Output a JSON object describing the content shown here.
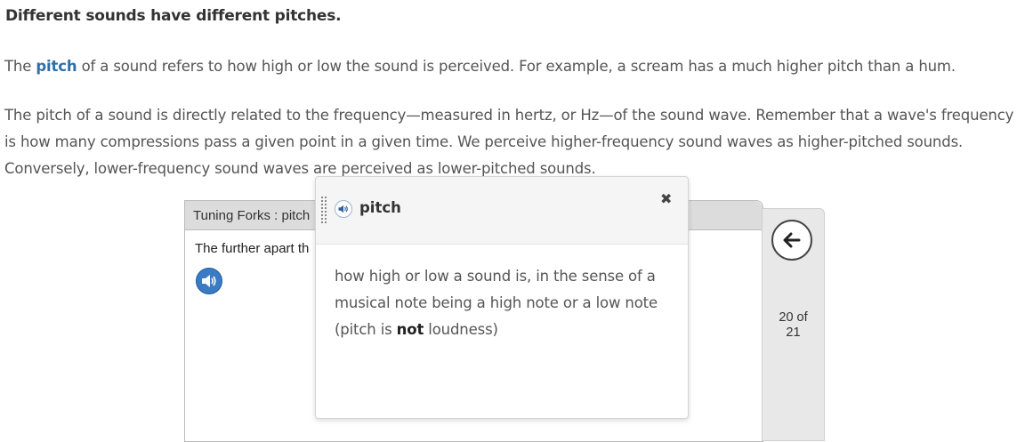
{
  "heading": "Different sounds have different pitches.",
  "paragraph1": {
    "pre": "The ",
    "term": "pitch",
    "post": " of a sound refers to how high or low the sound is perceived. For example, a scream has a much higher pitch than a hum."
  },
  "paragraph2": "The pitch of a sound is directly related to the frequency—measured in hertz, or Hz—of the sound wave. Remember that a wave's frequency is how many compressions pass a given point in a given time. We perceive higher-frequency sound waves as higher-pitched sounds. Conversely, lower-frequency sound waves are perceived as lower-pitched sounds.",
  "panel": {
    "title": "Tuning Forks : pitch",
    "text": "The further apart th",
    "audio_icon": "speaker-icon"
  },
  "nav": {
    "back_icon": "arrow-left-icon",
    "page_current": "20 of",
    "page_total": "21"
  },
  "popover": {
    "word": "pitch",
    "close_glyph": "✖",
    "definition_pre": "how high or low a sound is, in the sense of a musical note being a high note or a low note (pitch is ",
    "definition_bold": "not",
    "definition_post": " loudness)"
  },
  "colors": {
    "term": "#2f6fa8",
    "audio_button": "#3b7bc4"
  }
}
